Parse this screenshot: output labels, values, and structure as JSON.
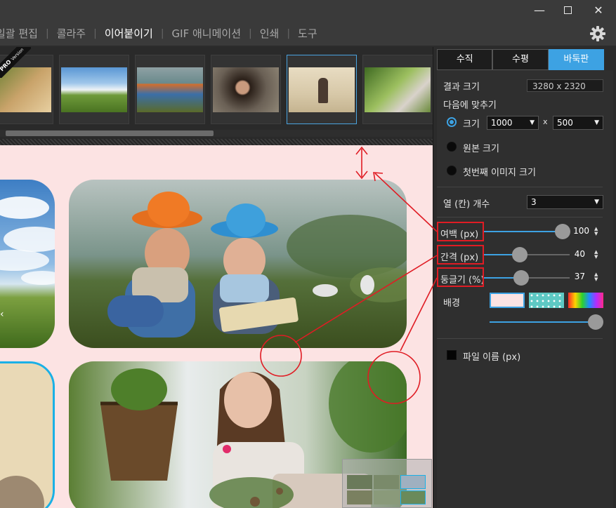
{
  "window": {
    "minimize_glyph": "—",
    "close_glyph": "✕"
  },
  "menu": {
    "items": [
      {
        "label": "일괄 편집",
        "active": false
      },
      {
        "label": "콜라주",
        "active": false
      },
      {
        "label": "이어붙이기",
        "active": true
      },
      {
        "label": "GIF 애니메이션",
        "active": false
      },
      {
        "label": "인쇄",
        "active": false
      },
      {
        "label": "도구",
        "active": false
      }
    ],
    "separator": "|"
  },
  "strip": {
    "pro_badge": "PRO",
    "pro_badge_sub": "Version",
    "thumbnails": [
      "girl-portrait",
      "bicycle-field",
      "two-kids-grass",
      "woman-portrait",
      "boy-on-beach",
      "girl-with-flowers"
    ],
    "selected_index": 4
  },
  "panel": {
    "tabs": [
      {
        "label": "수직",
        "active": false
      },
      {
        "label": "수평",
        "active": false
      },
      {
        "label": "바둑판",
        "active": true
      }
    ],
    "result_size_label": "결과 크기",
    "result_size_value": "3280 x 2320",
    "fit_label": "다음에 맞추기",
    "size_option_label": "크기",
    "size_width": "1000",
    "size_times": "x",
    "size_height": "500",
    "original_size_label": "원본 크기",
    "first_image_size_label": "첫번째 이미지 크기",
    "columns_label": "열 (칸) 개수",
    "columns_value": "3",
    "margin_label": "여백 (px)",
    "margin_value": "100",
    "margin_fraction": 0.87,
    "spacing_label": "간격 (px)",
    "spacing_value": "40",
    "spacing_fraction": 0.35,
    "roundness_label": "둥글기 (%)",
    "roundness_value": "37",
    "roundness_fraction": 0.37,
    "background_label": "배경",
    "background_slider_fraction": 1.0,
    "filename_label": "파일 이름 (px)"
  },
  "colors": {
    "accent": "#3da2e3",
    "canvas_bg": "#fce3e3",
    "annotation_red": "#e01c24",
    "selected_tile_border": "#1ab0e6"
  }
}
